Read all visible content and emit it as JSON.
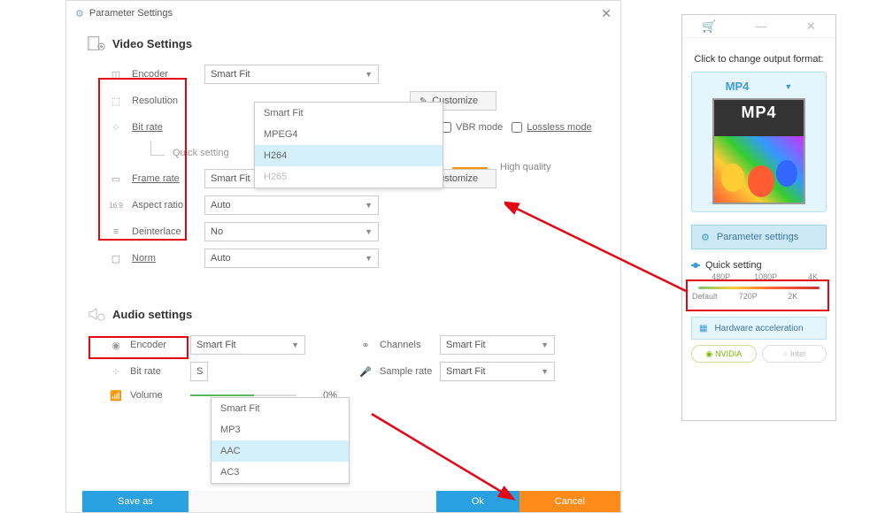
{
  "dialog": {
    "title": "Parameter Settings",
    "video_section": "Video Settings",
    "audio_section": "Audio settings",
    "labels": {
      "encoder": "Encoder",
      "resolution": "Resolution",
      "bitrate": "Bit rate",
      "quicksetting": "Quick setting",
      "framerate": "Frame rate",
      "aspect": "Aspect ratio",
      "deinterlace": "Deinterlace",
      "norm": "Norm",
      "channels": "Channels",
      "samplerate": "Sample rate",
      "volume": "Volume"
    },
    "values": {
      "encoder_sel": "Smart Fit",
      "framerate_sel": "Smart Fit",
      "aspect_sel": "Auto",
      "deinterlace_sel": "No",
      "norm_sel": "Auto",
      "audio_encoder_sel": "Smart Fit",
      "audio_bitrate_sel": "S",
      "channels_sel": "Smart Fit",
      "samplerate_sel": "Smart Fit",
      "volume_pct": "0%"
    },
    "encoder_options": [
      "Smart Fit",
      "MPEG4",
      "H264",
      "H265"
    ],
    "audio_encoder_options": [
      "Smart Fit",
      "MP3",
      "AAC",
      "AC3"
    ],
    "customize": "Customize",
    "vbr_mode": "VBR mode",
    "lossless_mode": "Lossless mode",
    "high_quality": "High quality",
    "buttons": {
      "save_as": "Save as",
      "ok": "Ok",
      "cancel": "Cancel"
    }
  },
  "side": {
    "hint": "Click to change output format:",
    "format": "MP4",
    "param_settings": "Parameter settings",
    "quick_setting": "Quick setting",
    "ticks_top": [
      "480P",
      "1080P",
      "4K"
    ],
    "ticks_bottom": [
      "Default",
      "720P",
      "2K"
    ],
    "hw_accel": "Hardware acceleration",
    "nvidia": "NVIDIA",
    "intel": "Intel"
  }
}
